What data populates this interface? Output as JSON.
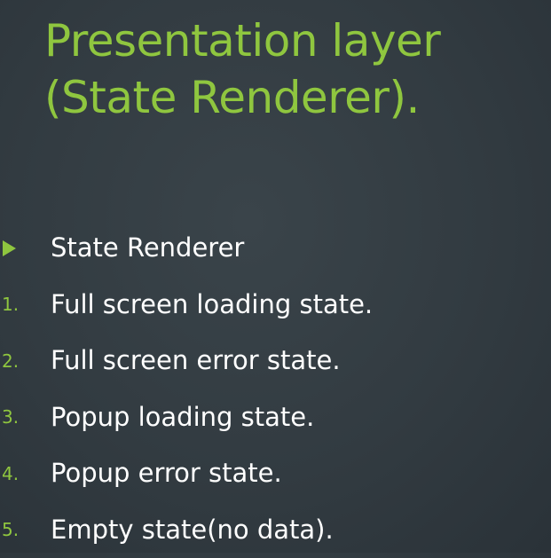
{
  "slide": {
    "title_line1": "Presentation layer",
    "title_line2": "(State Renderer).",
    "accent_color": "#8fc63f",
    "text_color": "#ffffff",
    "background_color": "#333c42",
    "items": [
      {
        "marker": "",
        "marker_icon": "triangle-bullet-icon",
        "text": "State Renderer"
      },
      {
        "marker": "1.",
        "text": "Full screen loading state."
      },
      {
        "marker": "2.",
        "text": "Full screen error state."
      },
      {
        "marker": "3.",
        "text": "Popup loading state."
      },
      {
        "marker": "4.",
        "text": "Popup error state."
      },
      {
        "marker": "5.",
        "text": "Empty state(no data)."
      }
    ]
  }
}
